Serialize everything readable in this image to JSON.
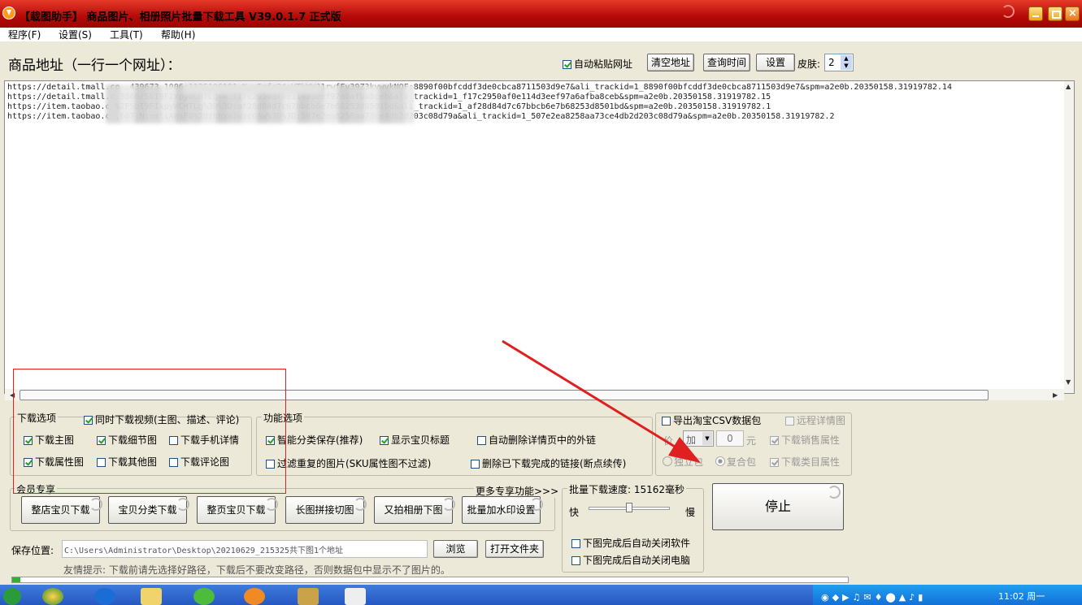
{
  "window": {
    "title": "【载图助手】 商品图片、相册照片批量下载工具 V39.0.1.7 正式版"
  },
  "menu": [
    "程序(F)",
    "设置(S)",
    "工具(T)",
    "帮助(H)"
  ],
  "top": {
    "page_label": "商品地址（一行一个网址）：",
    "auto_paste": "自动粘贴网址",
    "clear_btn": "清空地址",
    "query_btn": "查询时间",
    "settings_btn": "设置",
    "skin_label": "皮肤:",
    "skin_value": "2"
  },
  "urls": [
    "https://detail.tmall.co                                                   .439673 1006:1125106191:N:y5zfr24aVTkWWJ1rwfFv39Z3kvwvkNOF:8890f00bfcddf3de0cbca8711503d9e7&ali_trackid=1_8890f00bfcddf3de0cbca8711503d9e7&spm=a2e0b.20350158.31919782.14",
    "https://detail.tmall.c                                                    3860/SbI9FIxpyWCHTLg==:f17c2950af0e114d3eef97a6afba8ceb&ali_trackid=1_f17c2950af0e114d3eef97a6afba8ceb&spm=a2e0b.20350158.31919782.15",
    "https://item.taobao.c                                                     %2FSbI9FIxpyWCHTLg%3D%3D:af28d84d7c67bbcb6e7b68253d8501bd&ali_trackid=1_af28d84d7c67bbcb6e7b68253d8501bd&spm=a2e0b.20350158.31919782.1",
    "https://item.taobao.c                                                     .607:N:emtiAWsF8%2BzhhxaiwzcOAw%3D%3D:507e2ea8258aa73ce4db2d203c08d79a&ali_trackid=1_507e2ea8258aa73ce4db2d203c08d79a&spm=a2e0b.20350158.31919782.2"
  ],
  "download_options": {
    "title": "下载选项",
    "video": "同时下载视频(主图、描述、评论)",
    "main_img": "下载主图",
    "detail_img": "下载细节图",
    "mobile_detail": "下载手机详情",
    "attr_img": "下载属性图",
    "other_img": "下载其他图",
    "review_img": "下载评论图"
  },
  "function_options": {
    "title": "功能选项",
    "smart_save": "智能分类保存(推荐)",
    "show_title": "显示宝贝标题",
    "auto_delete_links": "自动删除详情页中的外链",
    "filter_dup": "过滤重复的图片(SKU属性图不过滤)",
    "delete_done": "删除已下载完成的链接(断点续传)"
  },
  "export_options": {
    "export_csv": "导出淘宝CSV数据包",
    "remote_detail": "远程详情图",
    "price_label": "价",
    "price_op": "加",
    "price_value": "0",
    "price_unit": "元",
    "sales_attr": "下载销售属性",
    "single_pkg": "独立包",
    "combo_pkg": "复合包",
    "category_attr": "下载类目属性"
  },
  "vip": {
    "title": "会员专享",
    "more": "更多专享功能>>>",
    "buttons": [
      "整店宝贝下载",
      "宝贝分类下载",
      "整页宝贝下载",
      "长图拼接切图",
      "又拍相册下图",
      "批量加水印设置"
    ]
  },
  "speed": {
    "title": "批量下载速度: 15162毫秒",
    "fast": "快",
    "slow": "慢",
    "slider_value": 0.5,
    "close_app": "下图完成后自动关闭软件",
    "shutdown": "下图完成后自动关闭电脑"
  },
  "stop_btn": "停止",
  "save": {
    "label": "保存位置:",
    "path": "C:\\Users\\Administrator\\Desktop\\20210629_215325共下图1个地址",
    "browse": "浏览",
    "open_folder": "打开文件夹",
    "tip": "友情提示: 下载前请先选择好路径，下载后不要改变路径，否则数据包中显示不了图片的。"
  },
  "progress": {
    "value": 0.01
  },
  "taskbar": {
    "clock": "11:02 周一"
  },
  "colors": {
    "title_bar": "#c4140f",
    "annotation_red": "#e02020",
    "check_green": "#21a121"
  }
}
